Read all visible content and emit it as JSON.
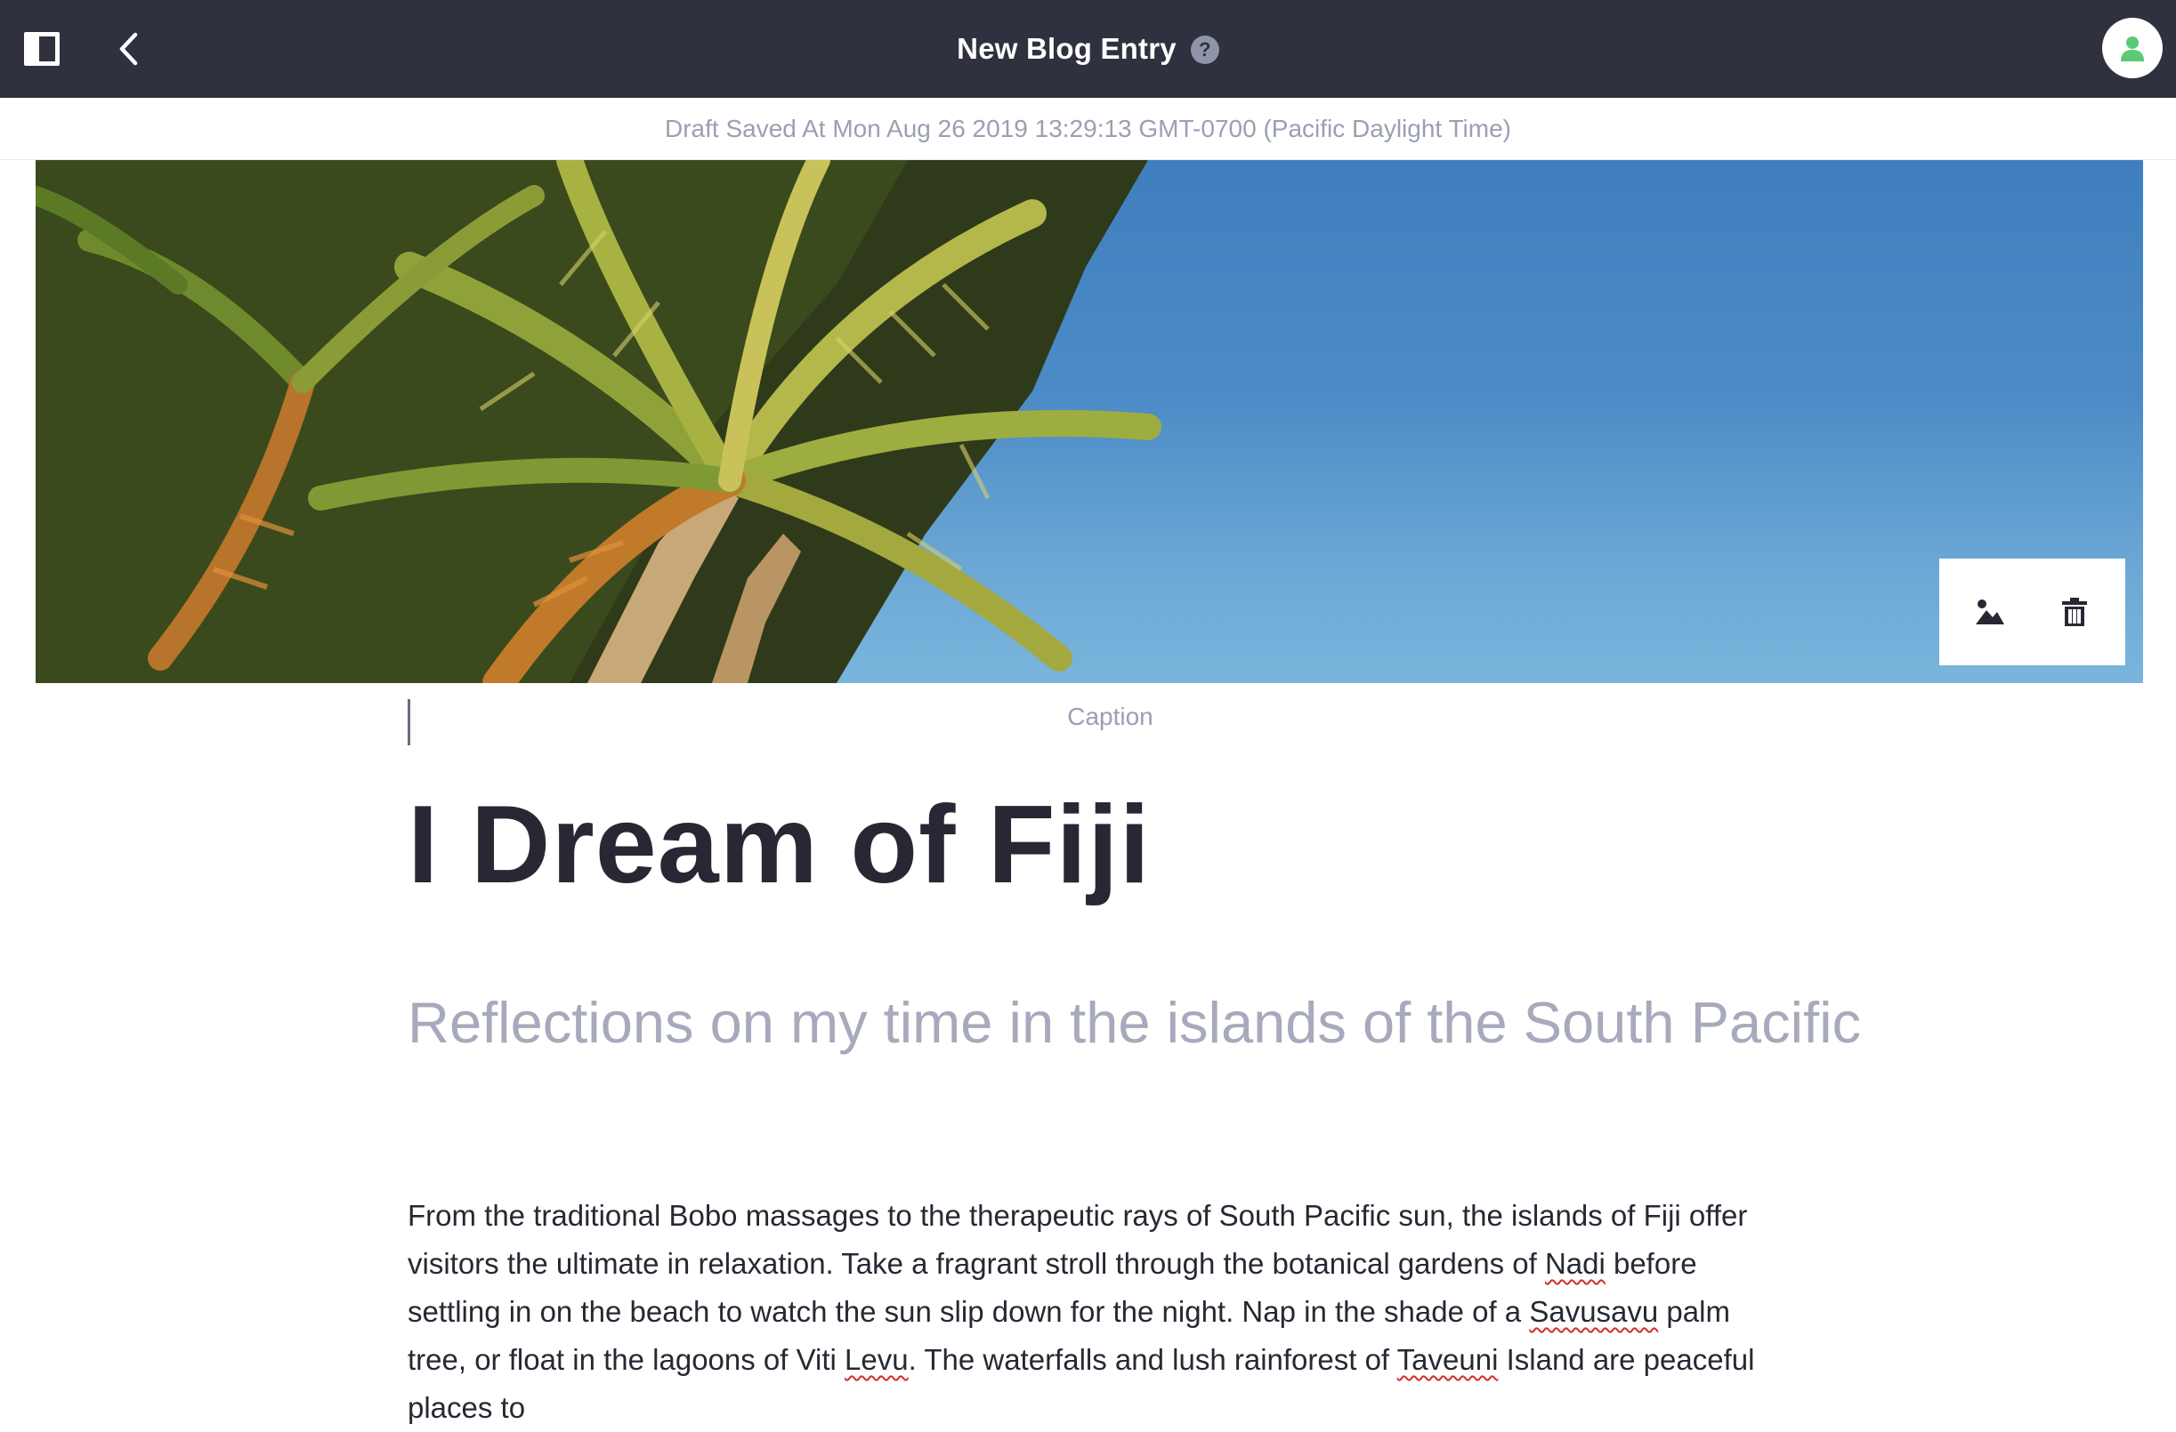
{
  "header": {
    "title": "New Blog Entry",
    "help_icon": "question-circle-icon",
    "help_glyph": "?",
    "sidebar_toggle_icon": "sidebar-toggle-icon",
    "back_icon": "chevron-left-icon",
    "avatar_icon": "user-icon"
  },
  "status": {
    "draft_saved": "Draft Saved At Mon Aug 26 2019 13:29:13 GMT-0700 (Pacific Daylight Time)"
  },
  "cover_image": {
    "subject": "palm trees against blue sky",
    "toolbar": {
      "change_icon": "image-icon",
      "delete_icon": "trash-icon"
    }
  },
  "caption": {
    "placeholder": "Caption"
  },
  "article": {
    "title": "I Dream of Fiji",
    "subtitle": "Reflections on my time in the islands of the South Pacific",
    "body": {
      "p1": "From the traditional Bobo massages to the therapeutic rays of South Pacific sun, the islands of Fiji offer visitors the ultimate in relaxation. Take a fragrant stroll through the botanical gardens of ",
      "w1": "Nadi",
      "p2": " before settling in on the beach to watch the sun slip down for the night. Nap in the shade of a ",
      "w2": "Savusavu",
      "p3": " palm tree, or float in the lagoons of Viti ",
      "w3": "Levu",
      "p4": ". The waterfalls and lush rainforest of ",
      "w4": "Taveuni",
      "p5": " Island are peaceful places to"
    }
  },
  "colors": {
    "topbar": "#30313f",
    "status_text": "#9aa0b2",
    "title_text": "#272833",
    "subtitle_text": "#a7a9bc",
    "avatar_accent": "#5aca75",
    "spellcheck": "#d12d2d"
  }
}
